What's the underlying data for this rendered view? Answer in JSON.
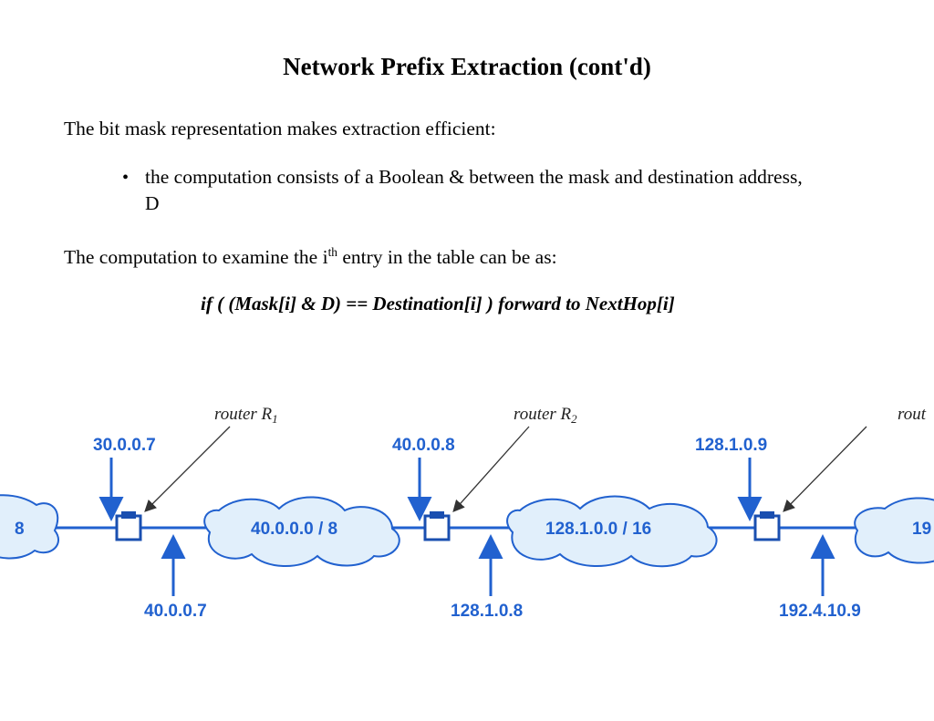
{
  "title": "Network Prefix Extraction (cont'd)",
  "intro": "The bit mask representation makes extraction efficient:",
  "bullet": "the computation consists of a Boolean & between the mask and destination address, D",
  "line2_a": "The computation to examine the i",
  "line2_sup": "th",
  "line2_b": " entry in the table can be as:",
  "code": "if ( (Mask[i] & D) == Destination[i] )  forward to NextHop[i]",
  "diagram": {
    "router1_label": "router R",
    "router1_sub": "1",
    "router2_label": "router R",
    "router2_sub": "2",
    "router3_partial": "rout",
    "addr_top_1": "30.0.0.7",
    "addr_top_2": "40.0.0.8",
    "addr_top_3": "128.1.0.9",
    "addr_bot_1": "40.0.0.7",
    "addr_bot_2": "128.1.0.8",
    "addr_bot_3": "192.4.10.9",
    "cloud_left_partial": "8",
    "cloud_mid1": "40.0.0.0 / 8",
    "cloud_mid2": "128.1.0.0 / 16",
    "cloud_right_partial": "19"
  }
}
